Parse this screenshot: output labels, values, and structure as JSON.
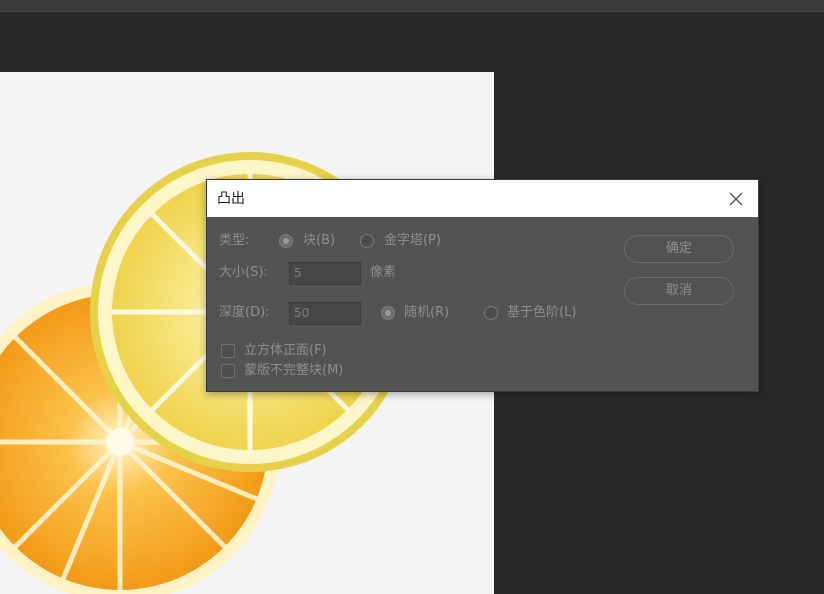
{
  "dialog": {
    "title": "凸出",
    "type_label": "类型:",
    "type_options": [
      {
        "label": "块(B)",
        "selected": true
      },
      {
        "label": "金字塔(P)",
        "selected": false
      }
    ],
    "size_label": "大小(S):",
    "size_value": "5",
    "size_unit": "像素",
    "depth_label": "深度(D):",
    "depth_value": "50",
    "depth_options": [
      {
        "label": "随机(R)",
        "selected": true
      },
      {
        "label": "基于色阶(L)",
        "selected": false
      }
    ],
    "checkbox_solid_front": "立方体正面(F)",
    "checkbox_mask_incomplete": "蒙版不完整块(M)",
    "ok_button": "确定",
    "cancel_button": "取消"
  },
  "colors": {
    "app_background": "#282828",
    "dialog_background": "#535353",
    "titlebar_background": "#ffffff",
    "document_background": "#f4f4f4",
    "orange": "#f5a623",
    "lemon": "#f3dc62"
  }
}
